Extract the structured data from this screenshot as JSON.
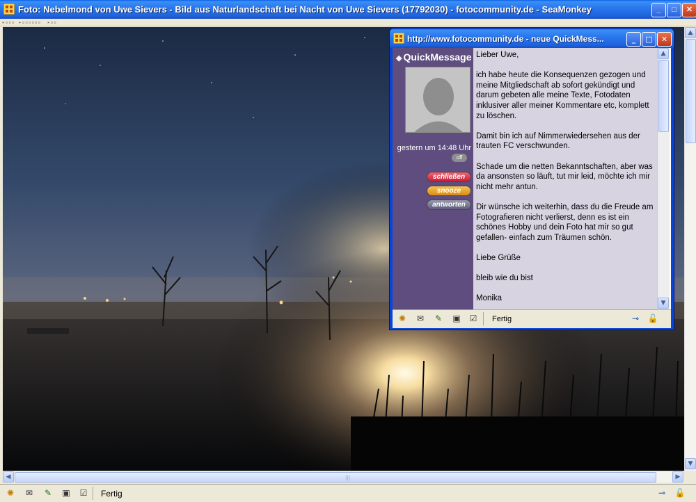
{
  "main_window": {
    "title": "Foto: Nebelmond von Uwe Sievers - Bild aus Naturlandschaft bei Nacht von Uwe Sievers (17792030) - fotocommunity.de - SeaMonkey",
    "status_text": "Fertig",
    "buttons": {
      "minimize": "_",
      "maximize": "□",
      "close": "✕"
    },
    "status_icons": [
      "navigator-icon",
      "mail-icon",
      "composer-icon",
      "address-book-icon",
      "chatzilla-icon"
    ]
  },
  "popup": {
    "title": "http://www.fotocommunity.de - neue QuickMess...",
    "quickmessage_logo": "QuickMessage",
    "timestamp": "gestern um 14:48 Uhr",
    "online_status": "off",
    "buttons": [
      {
        "label": "schließen",
        "color": "#d9314a"
      },
      {
        "label": "snooze",
        "color": "#e7a128"
      },
      {
        "label": "antworten",
        "color": "#6a6a8a"
      }
    ],
    "message": {
      "paragraphs": [
        "Lieber Uwe,",
        "ich habe heute die Konsequenzen gezogen und meine Mitgliedschaft ab sofort gekündigt und darum gebeten alle meine Texte, Fotodaten inklusiver aller meiner Kommentare etc, komplett zu löschen.",
        "Damit bin ich auf Nimmerwiedersehen aus der trauten FC verschwunden.",
        "Schade um die netten Bekanntschaften, aber was da ansonsten so läuft, tut mir leid, möchte ich mir nicht mehr antun.",
        "Dir wünsche ich weiterhin, dass du die Freude am Fotografieren nicht verlierst, denn es ist ein schönes Hobby und dein Foto hat mir so gut gefallen- einfach zum Träumen schön.",
        "Liebe Grüße",
        "bleib wie du bist",
        "Monika"
      ]
    },
    "status_text": "Fertig"
  },
  "colors": {
    "titlebar_blue": "#2a78ee",
    "quickmessage_sidebar": "#5e4d7e",
    "message_background": "#d7d3e0"
  }
}
